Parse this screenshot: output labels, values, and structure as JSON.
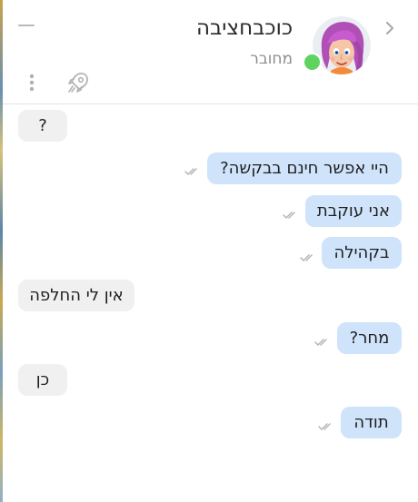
{
  "header": {
    "contact_name": "כוכבחציבה",
    "status": "מחובר",
    "online_color": "#5fd35f"
  },
  "colors": {
    "incoming_bubble": "#f0f0f0",
    "outgoing_bubble": "#cfe3fb",
    "read_ticks": "#b5b5b5"
  },
  "messages": [
    {
      "direction": "incoming",
      "text": "?"
    },
    {
      "direction": "outgoing",
      "text": "היי אפשר חינם בבקשה?",
      "status": "read"
    },
    {
      "direction": "outgoing",
      "text": "אני עוקבת",
      "status": "read"
    },
    {
      "direction": "outgoing",
      "text": "בקהילה",
      "status": "read"
    },
    {
      "direction": "incoming",
      "text": "אין לי החלפה"
    },
    {
      "direction": "outgoing",
      "text": "מחר?",
      "status": "read"
    },
    {
      "direction": "incoming",
      "text": "כן"
    },
    {
      "direction": "outgoing",
      "text": "תודה",
      "status": "read"
    }
  ],
  "icons": {
    "back": "chevron-right-icon",
    "minimize": "minimize-icon",
    "menu": "kebab-menu-icon",
    "boost": "rocket-icon"
  }
}
